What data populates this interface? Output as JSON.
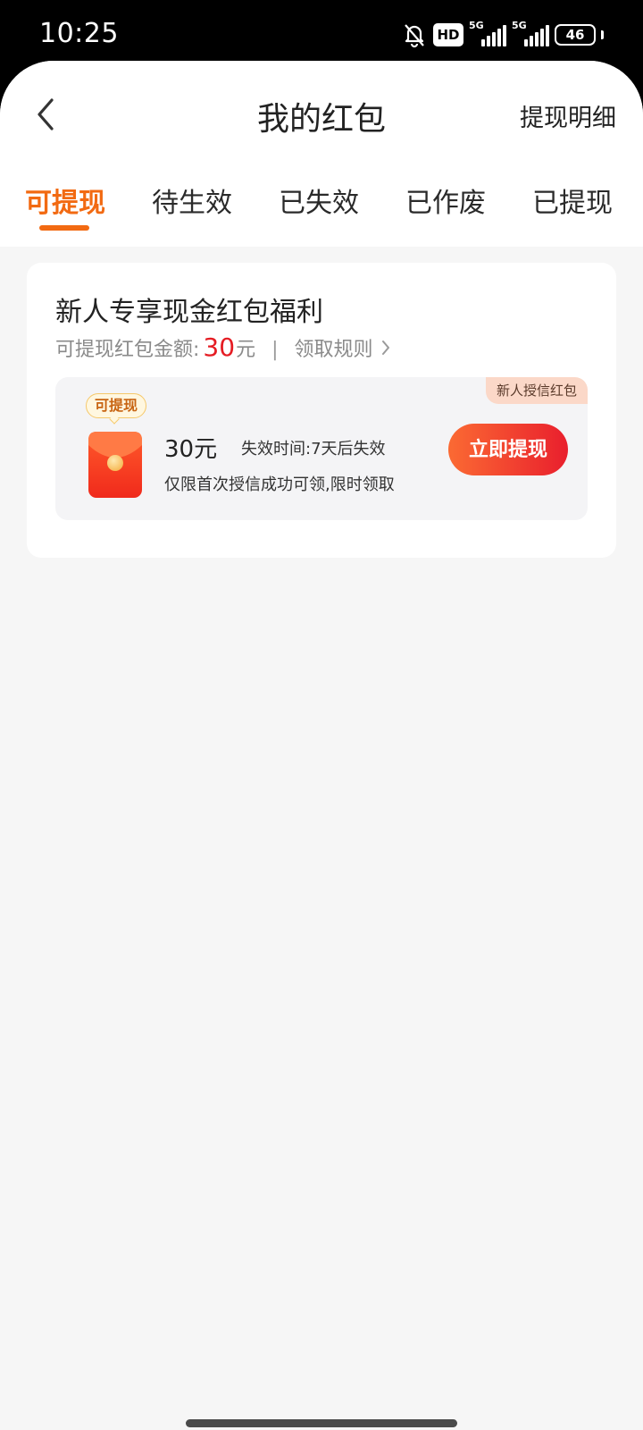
{
  "status_bar": {
    "time": "10:25",
    "hd_label": "HD",
    "sim1_label": "5G",
    "sim2_label": "5G",
    "battery": "46",
    "icons": [
      "bell-off-icon",
      "hd-icon",
      "signal-icon",
      "signal-icon",
      "battery-icon"
    ]
  },
  "nav": {
    "title": "我的红包",
    "right_link": "提现明细",
    "back_icon": "chevron-left-icon"
  },
  "tabs": [
    {
      "label": "可提现",
      "active": true
    },
    {
      "label": "待生效",
      "active": false
    },
    {
      "label": "已失效",
      "active": false
    },
    {
      "label": "已作废",
      "active": false
    },
    {
      "label": "已提现",
      "active": false
    }
  ],
  "card": {
    "title": "新人专享现金红包福利",
    "sub_label": "可提现红包金额:",
    "amount": "30",
    "unit": "元",
    "separator": "|",
    "rules_link": "领取规则",
    "coupon": {
      "corner_tag": "新人授信红包",
      "status_bubble": "可提现",
      "amount": "30元",
      "expire": "失效时间:7天后失效",
      "desc": "仅限首次授信成功可领,限时领取",
      "button": "立即提现",
      "icon": "red-envelope-icon"
    }
  },
  "colors": {
    "accent": "#f26a12",
    "amount_red": "#e51c23",
    "button_start": "#fb6a33",
    "button_end": "#e91f2d"
  }
}
